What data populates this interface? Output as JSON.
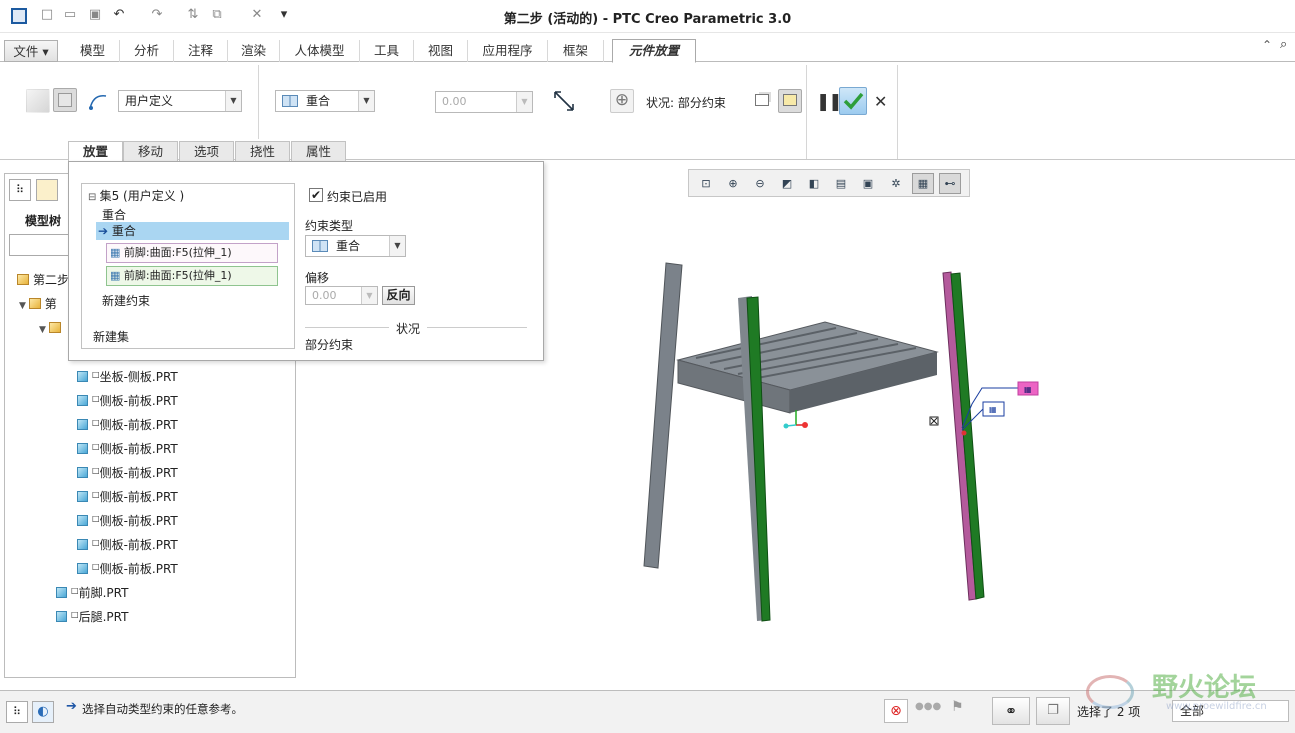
{
  "window": {
    "title": "第二步 (活动的) - PTC Creo Parametric 3.0"
  },
  "ribbon_tabs": [
    "文件",
    "模型",
    "分析",
    "注释",
    "渲染",
    "人体模型",
    "工具",
    "视图",
    "应用程序",
    "框架",
    "元件放置"
  ],
  "ribbon": {
    "constraint_set": "用户定义",
    "constraint_type": "重合",
    "offset_value": "0.00",
    "status": "状况: 部分约束"
  },
  "sub_tabs": [
    "放置",
    "移动",
    "选项",
    "挠性",
    "属性"
  ],
  "placement": {
    "set_title": "集5 (用户定义 )",
    "constraints": [
      "重合",
      "重合"
    ],
    "ref1": "前脚:曲面:F5(拉伸_1)",
    "ref2": "前脚:曲面:F5(拉伸_1)",
    "new_constraint": "新建约束",
    "new_set": "新建集",
    "enabled_label": "约束已启用",
    "type_label": "约束类型",
    "type_value": "重合",
    "offset_label": "偏移",
    "offset_value": "0.00",
    "flip_button": "反向",
    "status_label": "状况",
    "status_value": "部分约束"
  },
  "model_tree": {
    "label": "模型树",
    "root": "第二步",
    "sub": "第",
    "items": [
      "坐板-侧板.PRT",
      "侧板-前板.PRT",
      "侧板-前板.PRT",
      "侧板-前板.PRT",
      "侧板-前板.PRT",
      "侧板-前板.PRT",
      "侧板-前板.PRT",
      "侧板-前板.PRT",
      "侧板-前板.PRT",
      "前脚.PRT",
      "后腿.PRT"
    ]
  },
  "statusbar": {
    "message": "选择自动类型约束的任意参考。",
    "selection": "选择了 2 项",
    "filter": "全部",
    "watermark": "野火论坛",
    "watermark_url": "www.proewildfire.cn"
  },
  "colors": {
    "accent": "#4aa3df",
    "ok_green": "#2e9e3a",
    "leg_green": "#1f7a24",
    "leg_pink": "#b45a9c"
  }
}
